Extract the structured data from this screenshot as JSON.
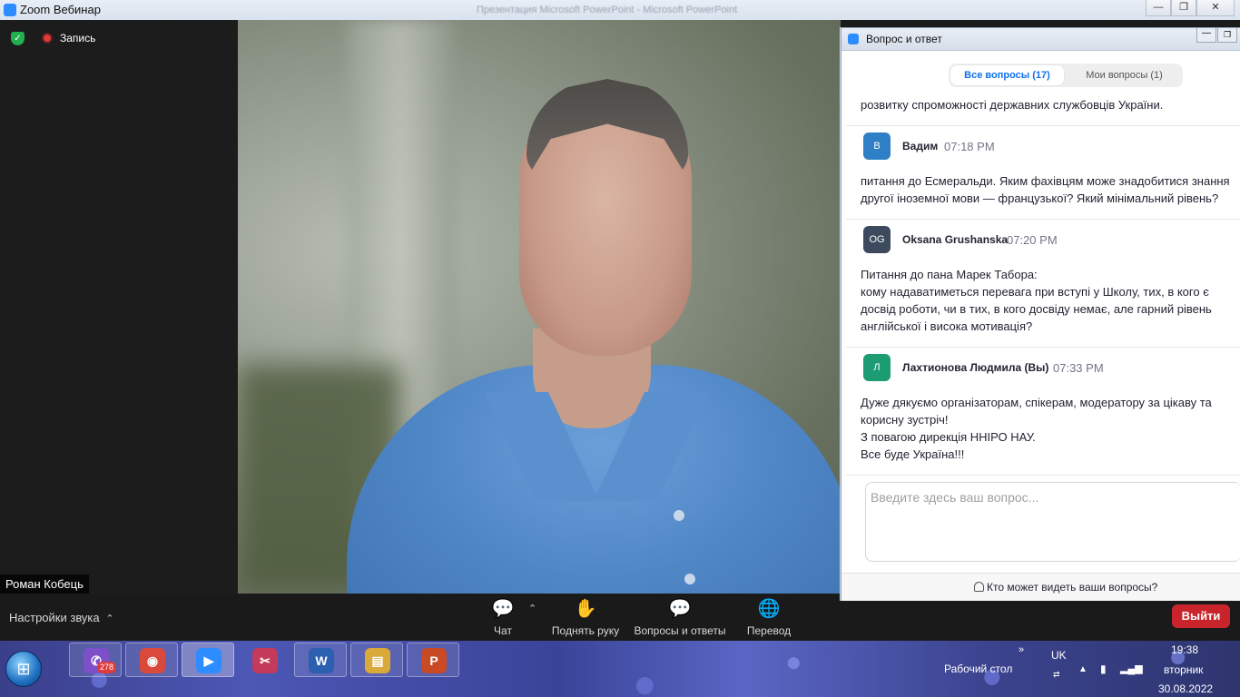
{
  "window": {
    "title": "Zoom Вебинар",
    "background_title": "Презентация Microsoft PowerPoint - Microsoft PowerPoint",
    "controls": [
      "—",
      "❐",
      "✕"
    ]
  },
  "recording": {
    "label": "Запись"
  },
  "speaker": {
    "name": "Роман Кобець"
  },
  "toolbar": {
    "audio_settings": "Настройки звука",
    "items": [
      {
        "label": "Чат",
        "icon": "chat-icon",
        "glyph": "💬"
      },
      {
        "label": "Поднять руку",
        "icon": "raise-hand-icon",
        "glyph": "✋"
      },
      {
        "label": "Вопросы и ответы",
        "icon": "qa-icon",
        "glyph": "💬"
      },
      {
        "label": "Перевод",
        "icon": "globe-icon",
        "glyph": "🌐"
      }
    ],
    "leave": "Выйти"
  },
  "qa": {
    "title": "Вопрос и ответ",
    "tabs": {
      "all": "Все вопросы (17)",
      "mine": "Мои вопросы (1)"
    },
    "top_text": "розвитку спроможності державних службовців України.",
    "questions": [
      {
        "initials": "В",
        "avatar_color": "#2e7fc5",
        "author": "Вадим",
        "time": "07:18 PM",
        "text": "питання до Есмеральди. Яким фахівцям може знадобитися знання\nдругої іноземної мови — французької? Який мінімальний рівень?"
      },
      {
        "initials": "OG",
        "avatar_color": "#3d4a5e",
        "author": "Oksana Grushanska",
        "time": "07:20 PM",
        "text": "Питання до пана Марек Табора:\nкому надаватиметься перевага при вступі у Школу, тих, в кого є\nдосвід роботи, чи в тих, в кого досвіду немає, але гарний рівень\nанглійської і висока мотивація?"
      },
      {
        "initials": "Л",
        "avatar_color": "#1d9b73",
        "author": "Лахтионова Людмила (Вы)",
        "time": "07:33 PM",
        "text": "Дуже дякуємо організаторам, спікерам, модератору за цікаву та\nкорисну зустріч!\nЗ повагою дирекція ННІРО НАУ.\nВсе буде Україна!!!"
      }
    ],
    "input_placeholder": "Введите здесь ваш вопрос...",
    "footer_link": "Кто может видеть ваши вопросы?"
  },
  "taskbar": {
    "apps": [
      {
        "name": "viber",
        "glyph": "✆",
        "color": "#7d4fc9",
        "badge": "278"
      },
      {
        "name": "chrome",
        "glyph": "◉",
        "color": "#d94a3c"
      },
      {
        "name": "zoom",
        "glyph": "▶",
        "color": "#2d8cff"
      },
      {
        "name": "scissors",
        "glyph": "✂",
        "color": "#c43a5a"
      },
      {
        "name": "word",
        "glyph": "W",
        "color": "#2b5fb0"
      },
      {
        "name": "explorer",
        "glyph": "▤",
        "color": "#d9a93a"
      },
      {
        "name": "powerpoint",
        "glyph": "P",
        "color": "#c94a25"
      }
    ],
    "desktop": "Рабочий стол",
    "lang": "UK",
    "time": "19:38",
    "weekday": "вторник",
    "date": "30.08.2022"
  }
}
